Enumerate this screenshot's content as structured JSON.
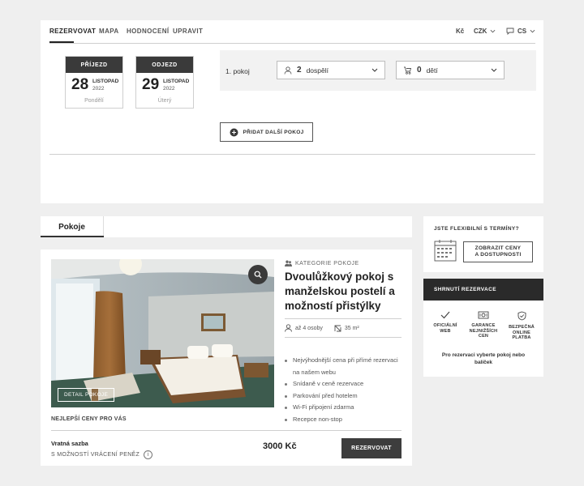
{
  "top_nav": {
    "tabs": [
      {
        "label": "REZERVOVAT"
      },
      {
        "label": "MAPA"
      },
      {
        "label": "HODNOCENÍ"
      },
      {
        "label": "UPRAVIT"
      }
    ],
    "currency_symbol": "Kč",
    "currency_code": "CZK",
    "language": "CS"
  },
  "dates": {
    "arrival": {
      "label": "PŘÍJEZD",
      "day": "28",
      "month": "LISTOPAD",
      "year": "2022",
      "weekday": "Pondělí"
    },
    "departure": {
      "label": "ODJEZD",
      "day": "29",
      "month": "LISTOPAD",
      "year": "2022",
      "weekday": "Úterý"
    }
  },
  "rooms_selector": {
    "room_label": "1. pokoj",
    "adults_count": "2",
    "adults_label": "dospělí",
    "children_count": "0",
    "children_label": "dětí",
    "add_room_label": "PŘIDAT DALŠÍ POKOJ"
  },
  "rooms_tab": {
    "label": "Pokoje"
  },
  "room": {
    "detail_label": "DETAIL POKOJE",
    "category_label": "KATEGORIE POKOJE",
    "title": "Dvoulůžkový pokoj s manželskou postelí a možností přistýlky",
    "capacity": "až 4 osoby",
    "size": "35 m²",
    "features": [
      "Nejvýhodnější cena při přímé rezervaci na našem webu",
      "Snídaně v ceně rezervace",
      "Parkování před hotelem",
      "Wi-Fi připojení zdarma",
      "Recepce non-stop"
    ],
    "best_price_label": "NEJLEPŠÍ CENY PRO VÁS",
    "rate_name": "Vratná sazba",
    "rate_note": "S MOŽNOSTÍ VRÁCENÍ PENĚZ",
    "price": "3000 Kč",
    "book_label": "REZERVOVAT"
  },
  "flexible": {
    "title": "JSTE FLEXIBILNÍ S TERMÍNY?",
    "button_line1": "ZOBRAZIT CENY",
    "button_line2": "A DOSTUPNOSTI"
  },
  "summary": {
    "title": "SHRNUTÍ REZERVACE",
    "usps": [
      {
        "line1": "OFICIÁLNÍ",
        "line2": "WEB",
        "line3": ""
      },
      {
        "line1": "GARANCE",
        "line2": "NEJNIŽŠÍCH",
        "line3": "CEN"
      },
      {
        "line1": "BEZPEČNÁ",
        "line2": "ONLINE",
        "line3": "PLATBA"
      }
    ],
    "note": "Pro rezervaci vyberte pokoj nebo balíček"
  },
  "colors": {
    "dark": "#3a3a3a",
    "accent_header": "#2a2a2a",
    "background": "#efefef"
  }
}
